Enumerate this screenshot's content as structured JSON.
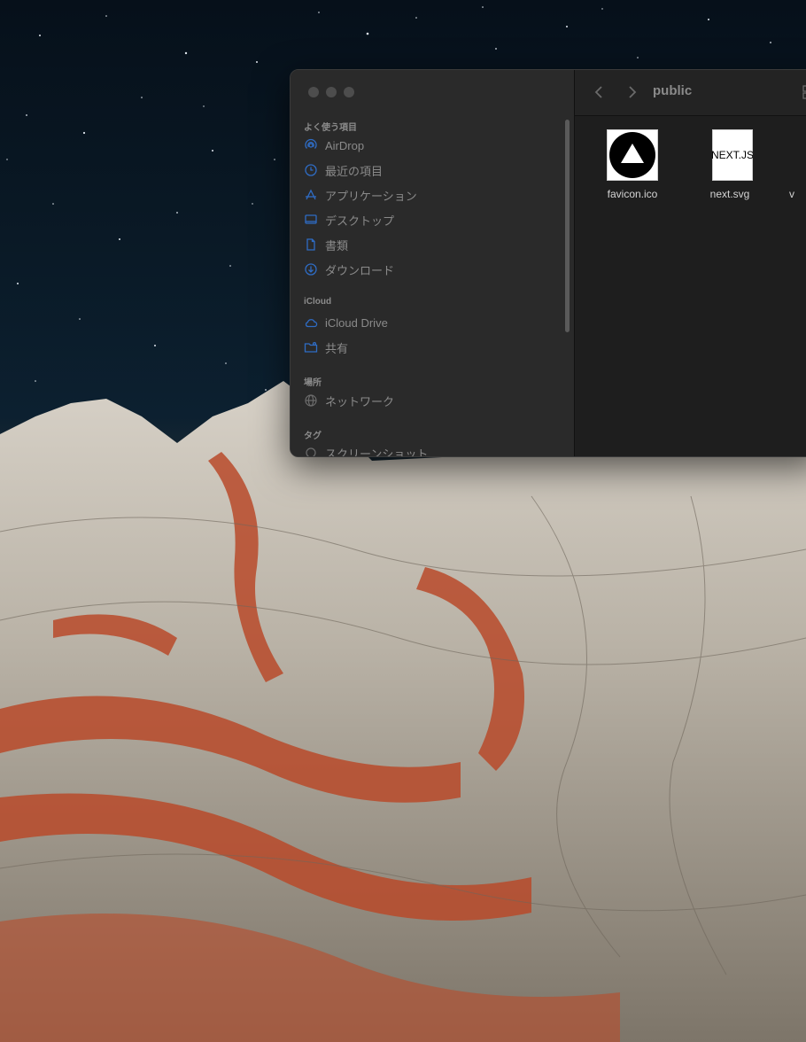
{
  "window": {
    "path_title": "public",
    "nav": {
      "back_icon": "chevron-left-icon",
      "forward_icon": "chevron-right-icon"
    }
  },
  "sidebar": {
    "favorites_title": "よく使う項目",
    "favorites": [
      {
        "label": "AirDrop",
        "icon": "airdrop-icon"
      },
      {
        "label": "最近の項目",
        "icon": "clock-icon"
      },
      {
        "label": "アプリケーション",
        "icon": "applications-icon"
      },
      {
        "label": "デスクトップ",
        "icon": "desktop-icon"
      },
      {
        "label": "書類",
        "icon": "document-icon"
      },
      {
        "label": "ダウンロード",
        "icon": "download-icon"
      }
    ],
    "icloud_title": "iCloud",
    "icloud": [
      {
        "label": "iCloud Drive",
        "icon": "cloud-icon"
      },
      {
        "label": "共有",
        "icon": "shared-folder-icon"
      }
    ],
    "locations_title": "場所",
    "locations": [
      {
        "label": "ネットワーク",
        "icon": "globe-icon"
      }
    ],
    "tags_title": "タグ",
    "tags": [
      {
        "label": "スクリーンショット",
        "icon": "tag-icon"
      }
    ]
  },
  "files": [
    {
      "name": "favicon.ico",
      "icon": "vercel-triangle-icon"
    },
    {
      "name": "next.svg",
      "icon": "nextjs-logo-icon",
      "logo_text": "NEXT.JS"
    },
    {
      "name": "v",
      "icon": "file-icon"
    }
  ],
  "colors": {
    "window_bg": "#1f1f1f",
    "sidebar_bg": "#2a2a2a",
    "accent_icon": "#2f6cc4"
  }
}
